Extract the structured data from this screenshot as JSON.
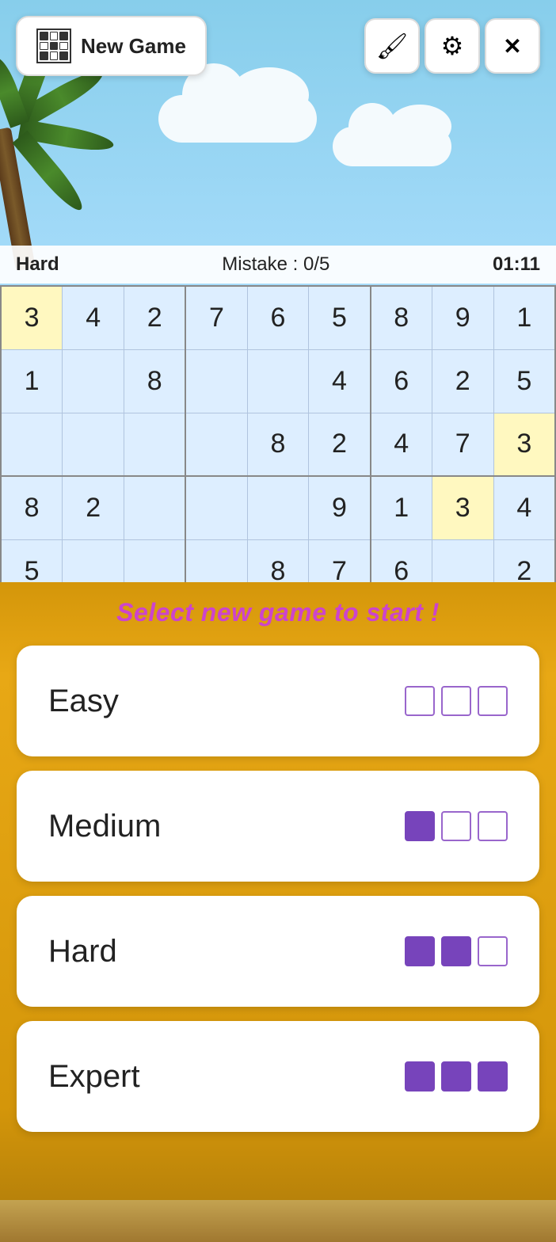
{
  "header": {
    "new_game_label": "New Game",
    "paint_icon": "🖌",
    "settings_icon": "⚙",
    "close_icon": "✕"
  },
  "status": {
    "difficulty": "Hard",
    "mistakes_label": "Mistake : 0/5",
    "time": "01:11"
  },
  "grid": {
    "rows": [
      [
        "3",
        "4",
        "2",
        "7",
        "6",
        "5",
        "8",
        "9",
        "1"
      ],
      [
        "1",
        "",
        "8",
        "",
        "",
        "4",
        "6",
        "2",
        "5"
      ],
      [
        "",
        "",
        "",
        "",
        "8",
        "2",
        "4",
        "7",
        "3"
      ],
      [
        "8",
        "2",
        "",
        "",
        "",
        "9",
        "1",
        "3",
        "4"
      ],
      [
        "5",
        "",
        "",
        "",
        "8",
        "7",
        "6",
        "",
        "2"
      ]
    ],
    "highlighted_cells": [
      [
        0,
        0
      ],
      [
        2,
        8
      ],
      [
        3,
        7
      ]
    ],
    "note": "partial grid shown"
  },
  "overlay": {
    "select_text": "Select new game to start !",
    "difficulties": [
      {
        "label": "Easy",
        "filled": 0,
        "total": 3
      },
      {
        "label": "Medium",
        "filled": 1,
        "total": 3
      },
      {
        "label": "Hard",
        "filled": 2,
        "total": 3
      },
      {
        "label": "Expert",
        "filled": 3,
        "total": 3
      }
    ]
  }
}
